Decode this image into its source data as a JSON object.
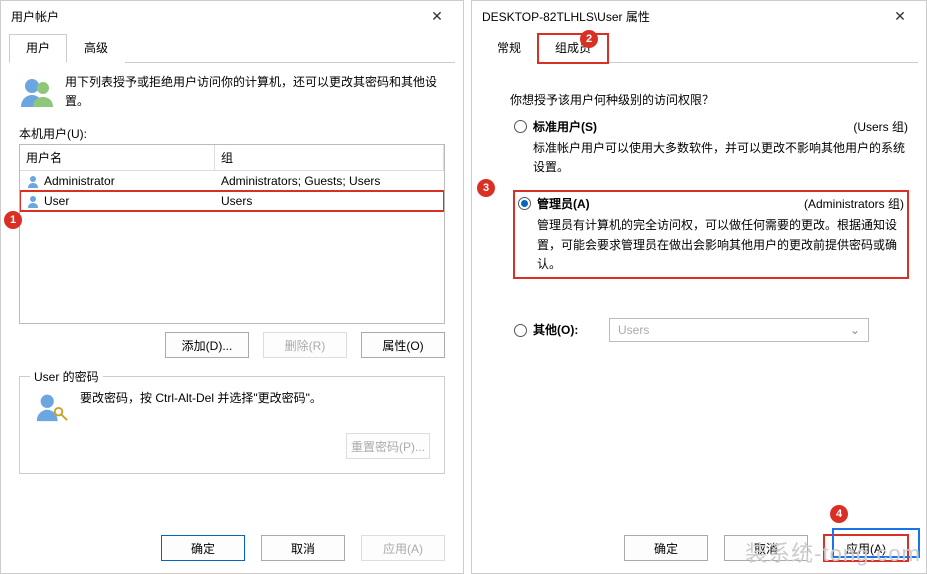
{
  "left": {
    "title": "用户帐户",
    "tabs": [
      "用户",
      "高级"
    ],
    "active_tab": 0,
    "intro": "用下列表授予或拒绝用户访问你的计算机，还可以更改其密码和其他设置。",
    "list_label": "本机用户(U):",
    "columns": [
      "用户名",
      "组"
    ],
    "rows": [
      {
        "name": "Administrator",
        "groups": "Administrators; Guests; Users"
      },
      {
        "name": "User",
        "groups": "Users"
      }
    ],
    "buttons": {
      "add": "添加(D)...",
      "remove": "删除(R)",
      "props": "属性(O)"
    },
    "password_group": {
      "title": "User 的密码",
      "text": "要改密码，按 Ctrl-Alt-Del 并选择\"更改密码\"。",
      "reset": "重置密码(P)..."
    },
    "bottom": {
      "ok": "确定",
      "cancel": "取消",
      "apply": "应用(A)"
    }
  },
  "right": {
    "title": "DESKTOP-82TLHLS\\User 属性",
    "tabs": [
      "常规",
      "组成员"
    ],
    "active_tab": 1,
    "question": "你想授予该用户何种级别的访问权限？",
    "options": [
      {
        "label": "标准用户(S)",
        "hint": "(Users 组)",
        "desc": "标准帐户用户可以使用大多数软件，并可以更改不影响其他用户的系统设置。",
        "checked": false
      },
      {
        "label": "管理员(A)",
        "hint": "(Administrators 组)",
        "desc": "管理员有计算机的完全访问权，可以做任何需要的更改。根据通知设置，可能会要求管理员在做出会影响其他用户的更改前提供密码或确认。",
        "checked": true
      },
      {
        "label": "其他(O):",
        "dropdown": "Users",
        "checked": false
      }
    ],
    "bottom": {
      "ok": "确定",
      "cancel": "取消",
      "apply": "应用(A)"
    }
  },
  "badges": [
    "1",
    "2",
    "3",
    "4"
  ],
  "watermark": "装系统-tong.com"
}
